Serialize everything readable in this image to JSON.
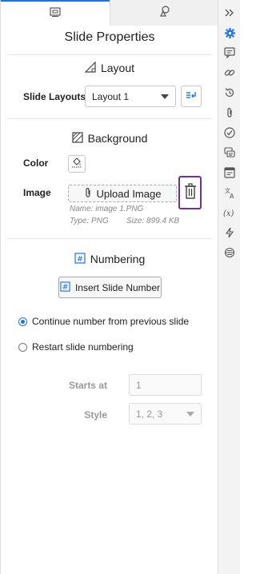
{
  "header": {
    "title": "Slide Properties"
  },
  "tabs": [
    {
      "label": "slide",
      "icon": "slide-icon",
      "active": true
    },
    {
      "label": "shapes",
      "icon": "shapes-icon",
      "active": false
    }
  ],
  "layout": {
    "heading": "Layout",
    "slide_layouts_label": "Slide Layouts",
    "selected_layout": "Layout 1",
    "apply_icon": "apply-layout-icon"
  },
  "background": {
    "heading": "Background",
    "color_label": "Color",
    "image_label": "Image",
    "upload_label": "Upload Image",
    "name_text": "Name: image 1.PNG",
    "type_text": "Type: PNG",
    "size_text": "Size: 899.4 KB"
  },
  "numbering": {
    "heading": "Numbering",
    "insert_button": "Insert Slide Number",
    "options": [
      {
        "label": "Continue number from previous slide",
        "checked": true
      },
      {
        "label": "Restart slide numbering",
        "checked": false
      }
    ],
    "starts_at_label": "Starts at",
    "starts_at_value": "1",
    "style_label": "Style",
    "style_value": "1, 2, 3"
  },
  "rail": {
    "icons": [
      "collapse-icon",
      "gear-icon",
      "comment-icon",
      "link-icon",
      "history-icon",
      "attachment-icon",
      "check-icon",
      "chat-icon",
      "notes-icon",
      "translate-icon",
      "variable-icon",
      "lightning-icon",
      "settings-panel-icon"
    ]
  },
  "colors": {
    "accent": "#1a73e8",
    "highlight": "#7a2d8f"
  }
}
